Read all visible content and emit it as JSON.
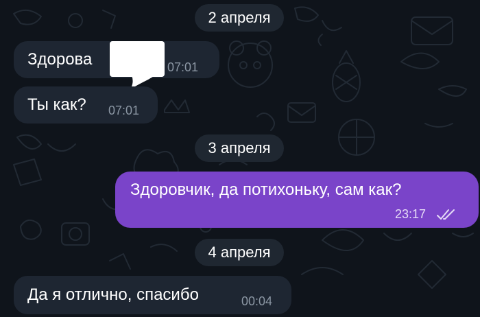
{
  "theme": {
    "background": "#0f141b",
    "incoming_bubble": "#1e2632",
    "outgoing_bubble": "#7a44c9",
    "date_pill": "#1f2731",
    "time_incoming": "#8b96a3",
    "time_outgoing": "#e6dcf6"
  },
  "dates": [
    "2 апреля",
    "3 апреля",
    "4 апреля"
  ],
  "messages": [
    {
      "direction": "incoming",
      "text": "Здорова",
      "time": "07:01",
      "redacted": true
    },
    {
      "direction": "incoming",
      "text": "Ты как?",
      "time": "07:01"
    },
    {
      "direction": "outgoing",
      "text": "Здоровчик, да потихоньку, сам как?",
      "time": "23:17",
      "status_icon": "double-check-icon"
    },
    {
      "direction": "incoming",
      "text": "Да я отлично, спасибо",
      "time": "00:04"
    }
  ]
}
